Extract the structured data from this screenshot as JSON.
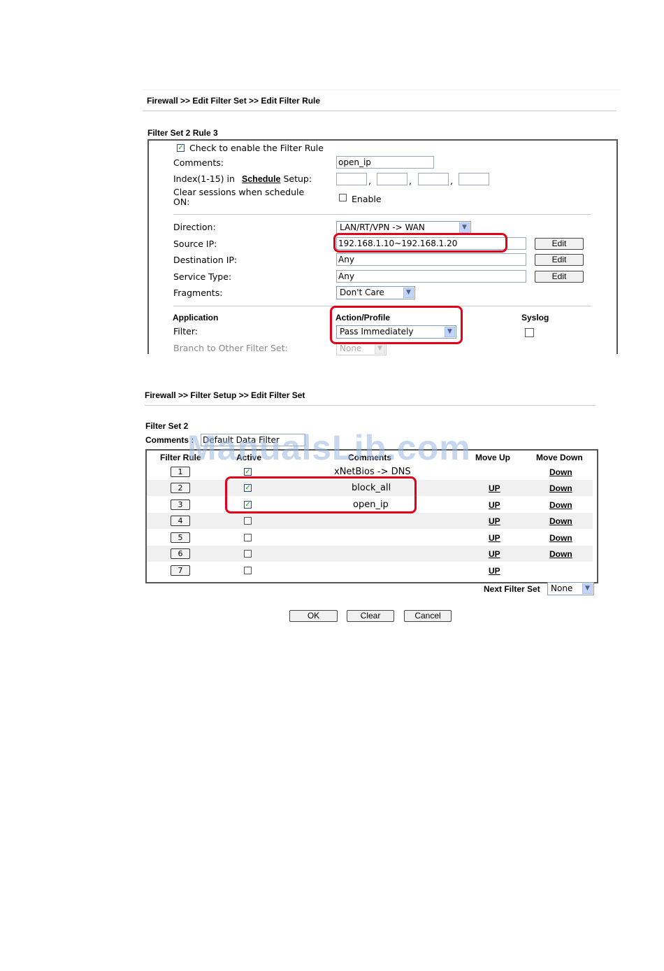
{
  "edit_rule": {
    "breadcrumb": "Firewall >> Edit Filter Set >> Edit Filter Rule",
    "section_title": "Filter Set 2 Rule 3",
    "enable_checkbox_label": "Check to enable the Filter Rule",
    "enable_checked": true,
    "comments_label": "Comments:",
    "comments_value": "open_ip",
    "index_label_prefix": "Index(1-15) in",
    "schedule_link": "Schedule",
    "index_label_suffix": "Setup:",
    "index_separators": [
      ",",
      ",",
      ","
    ],
    "clear_sessions_label_line1": "Clear sessions when schedule",
    "clear_sessions_label_line2": "ON:",
    "clear_sessions_enable_label": "Enable",
    "direction_label": "Direction:",
    "direction_value": "LAN/RT/VPN -> WAN",
    "source_ip_label": "Source IP:",
    "source_ip_value": "192.168.1.10~192.168.1.20",
    "destination_ip_label": "Destination IP:",
    "destination_ip_value": "Any",
    "service_type_label": "Service Type:",
    "service_type_value": "Any",
    "fragments_label": "Fragments:",
    "fragments_value": "Don't Care",
    "edit_button_label": "Edit",
    "application_header": "Application",
    "action_profile_header": "Action/Profile",
    "syslog_header": "Syslog",
    "filter_label": "Filter:",
    "filter_action_value": "Pass Immediately",
    "branch_label": "Branch to Other Filter Set:",
    "branch_value": "None"
  },
  "edit_set": {
    "breadcrumb": "Firewall >> Filter Setup >> Edit Filter Set",
    "section_title": "Filter Set 2",
    "comments_label": "Comments :",
    "comments_value": "Default Data Filter",
    "columns": {
      "filter_rule": "Filter Rule",
      "active": "Active",
      "comments": "Comments",
      "move_up": "Move Up",
      "move_down": "Move Down"
    },
    "rows": [
      {
        "num": "1",
        "active": true,
        "comment": "xNetBios -> DNS",
        "up": "",
        "down": "Down"
      },
      {
        "num": "2",
        "active": true,
        "comment": "block_all",
        "up": "UP",
        "down": "Down"
      },
      {
        "num": "3",
        "active": true,
        "comment": "open_ip",
        "up": "UP",
        "down": "Down"
      },
      {
        "num": "4",
        "active": false,
        "comment": "",
        "up": "UP",
        "down": "Down"
      },
      {
        "num": "5",
        "active": false,
        "comment": "",
        "up": "UP",
        "down": "Down"
      },
      {
        "num": "6",
        "active": false,
        "comment": "",
        "up": "UP",
        "down": "Down"
      },
      {
        "num": "7",
        "active": false,
        "comment": "",
        "up": "UP",
        "down": ""
      }
    ],
    "next_filter_set_label": "Next Filter Set",
    "next_filter_set_value": "None",
    "ok_label": "OK",
    "clear_label": "Clear",
    "cancel_label": "Cancel"
  },
  "watermark": "ManualsLib.com",
  "colors": {
    "highlight": "#e2001a",
    "check": "#1d9a1d",
    "row_alt": "#f0f0f0"
  }
}
